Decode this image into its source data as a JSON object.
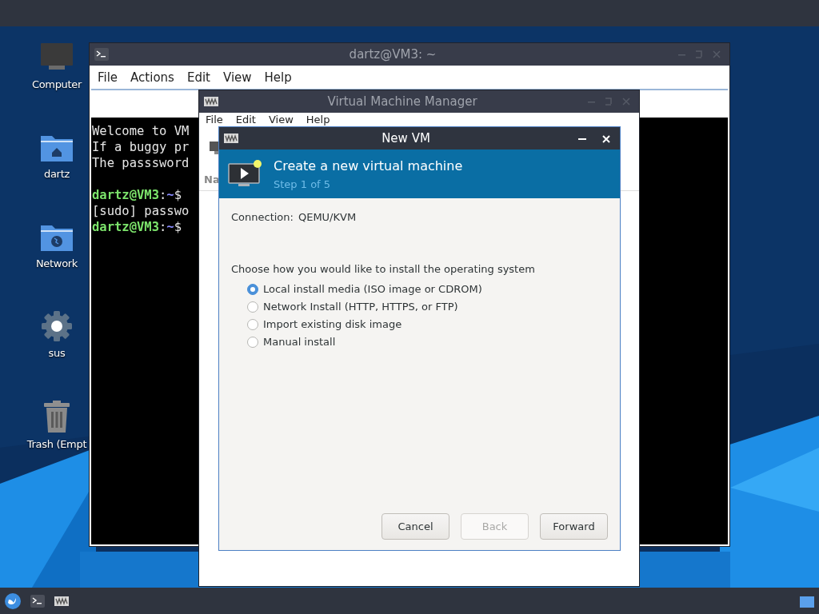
{
  "desktop_icons": [
    {
      "label": "Computer",
      "kind": "computer"
    },
    {
      "label": "dartz",
      "kind": "home"
    },
    {
      "label": "Network",
      "kind": "network"
    },
    {
      "label": "sus",
      "kind": "settings"
    },
    {
      "label": "Trash (Empt",
      "kind": "trash"
    }
  ],
  "terminal_window": {
    "title": "dartz@VM3: ~",
    "menu": [
      "File",
      "Actions",
      "Edit",
      "View",
      "Help"
    ],
    "blocks": [
      {
        "lines": [
          {
            "segments": [
              {
                "text": "Welcome to VM",
                "kind": "plain"
              }
            ]
          },
          {
            "segments": [
              {
                "text": "If a buggy pr",
                "kind": "plain"
              }
            ]
          },
          {
            "segments": [
              {
                "text": "The passsword",
                "kind": "plain"
              }
            ]
          }
        ]
      },
      {
        "lines": [
          {
            "segments": [
              {
                "text": "dartz@VM3",
                "kind": "prompt"
              },
              {
                "text": ":",
                "kind": "plain"
              },
              {
                "text": "~",
                "kind": "path"
              },
              {
                "text": "$",
                "kind": "plain"
              }
            ]
          },
          {
            "segments": [
              {
                "text": "[sudo] passwo",
                "kind": "plain"
              }
            ]
          },
          {
            "segments": [
              {
                "text": "dartz@VM3",
                "kind": "prompt"
              },
              {
                "text": ":",
                "kind": "plain"
              },
              {
                "text": "~",
                "kind": "path"
              },
              {
                "text": "$",
                "kind": "plain"
              }
            ]
          }
        ]
      }
    ]
  },
  "vmm_window": {
    "title": "Virtual Machine Manager",
    "menu": [
      "File",
      "Edit",
      "View",
      "Help"
    ],
    "column_header": "Na"
  },
  "dialog": {
    "title": "New VM",
    "header": {
      "title": "Create a new virtual machine",
      "subtitle": "Step 1 of 5"
    },
    "connection_label": "Connection:",
    "connection_value": "QEMU/KVM",
    "prompt": "Choose how you would like to install the operating system",
    "options": [
      {
        "label": "Local install media (ISO image or CDROM)",
        "selected": true
      },
      {
        "label": "Network Install (HTTP, HTTPS, or FTP)",
        "selected": false
      },
      {
        "label": "Import existing disk image",
        "selected": false
      },
      {
        "label": "Manual install",
        "selected": false
      }
    ],
    "buttons": [
      {
        "label": "Cancel",
        "disabled": false
      },
      {
        "label": "Back",
        "disabled": true
      },
      {
        "label": "Forward",
        "disabled": false
      }
    ]
  }
}
